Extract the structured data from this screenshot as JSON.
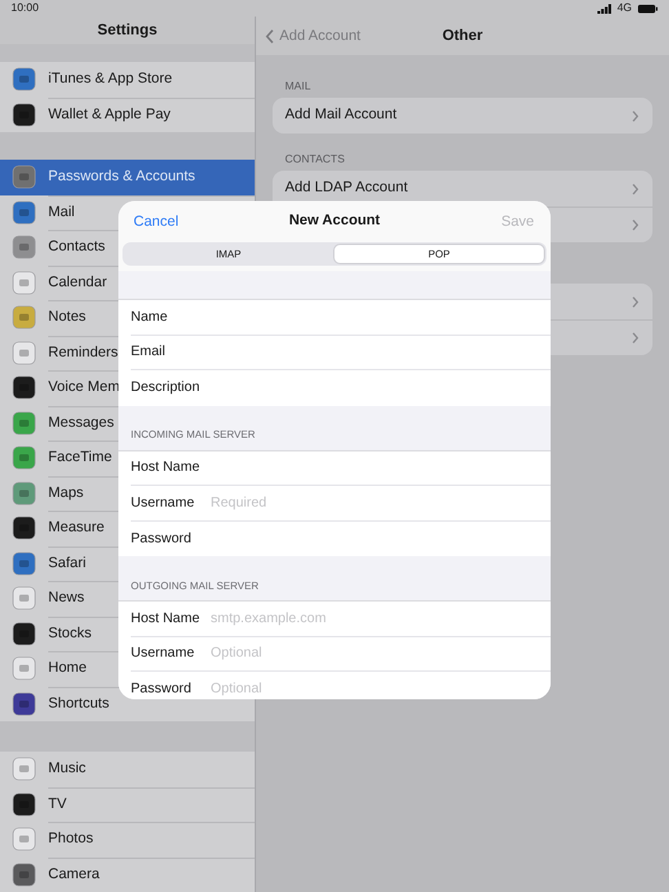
{
  "status_bar": {
    "time": "10:00",
    "network": "4G"
  },
  "sidebar": {
    "title": "Settings",
    "groups": [
      [
        {
          "label": "iTunes & App Store",
          "color": "#2f6fc0",
          "selected": false
        },
        {
          "label": "Wallet & Apple Pay",
          "color": "#1c1c1c",
          "selected": false
        }
      ],
      [
        {
          "label": "Passwords & Accounts",
          "color": "#707070",
          "selected": true
        },
        {
          "label": "Mail",
          "color": "#2f6fc0",
          "selected": false
        },
        {
          "label": "Contacts",
          "color": "#8e8e90",
          "selected": false
        },
        {
          "label": "Calendar",
          "color": "#e6e6e8",
          "selected": false
        },
        {
          "label": "Notes",
          "color": "#c8ac40",
          "selected": false
        },
        {
          "label": "Reminders",
          "color": "#e6e6e8",
          "selected": false
        },
        {
          "label": "Voice Mem",
          "color": "#1c1c1c",
          "selected": false
        },
        {
          "label": "Messages",
          "color": "#3aa64a",
          "selected": false
        },
        {
          "label": "FaceTime",
          "color": "#3aa64a",
          "selected": false
        },
        {
          "label": "Maps",
          "color": "#5f9a7a",
          "selected": false
        },
        {
          "label": "Measure",
          "color": "#1c1c1c",
          "selected": false
        },
        {
          "label": "Safari",
          "color": "#2f6fc0",
          "selected": false
        },
        {
          "label": "News",
          "color": "#e6e6e8",
          "selected": false
        },
        {
          "label": "Stocks",
          "color": "#1c1c1c",
          "selected": false
        },
        {
          "label": "Home",
          "color": "#e6e6e8",
          "selected": false
        },
        {
          "label": "Shortcuts",
          "color": "#3e3a98",
          "selected": false
        }
      ],
      [
        {
          "label": "Music",
          "color": "#e6e6e8",
          "selected": false
        },
        {
          "label": "TV",
          "color": "#1c1c1c",
          "selected": false
        },
        {
          "label": "Photos",
          "color": "#e6e6e8",
          "selected": false
        },
        {
          "label": "Camera",
          "color": "#5a5a5c",
          "selected": false
        }
      ]
    ]
  },
  "detail": {
    "back": "Add Account",
    "title": "Other",
    "sections": [
      {
        "header": "MAIL",
        "rows": [
          {
            "label": "Add Mail Account",
            "chevron": true
          }
        ]
      },
      {
        "header": "CONTACTS",
        "rows": [
          {
            "label": "Add LDAP Account",
            "chevron": true
          },
          {
            "chevron": true
          }
        ]
      },
      {
        "rows": [
          {
            "chevron": true
          },
          {
            "chevron": true
          }
        ]
      }
    ]
  },
  "modal": {
    "cancel": "Cancel",
    "title": "New Account",
    "save": "Save",
    "save_disabled": true,
    "tabs": [
      {
        "label": "IMAP",
        "selected": false
      },
      {
        "label": "POP",
        "selected": true
      }
    ],
    "sections": [
      {
        "fields": [
          {
            "label": "Name"
          },
          {
            "label": "Email"
          },
          {
            "label": "Description"
          }
        ]
      },
      {
        "header": "INCOMING MAIL SERVER",
        "fields": [
          {
            "label": "Host Name"
          },
          {
            "label": "Username",
            "placeholder": "Required"
          },
          {
            "label": "Password"
          }
        ]
      },
      {
        "header": "OUTGOING MAIL SERVER",
        "fields": [
          {
            "label": "Host Name",
            "placeholder": "smtp.example.com"
          },
          {
            "label": "Username",
            "placeholder": "Optional"
          },
          {
            "label": "Password",
            "placeholder": "Optional"
          }
        ]
      }
    ]
  }
}
